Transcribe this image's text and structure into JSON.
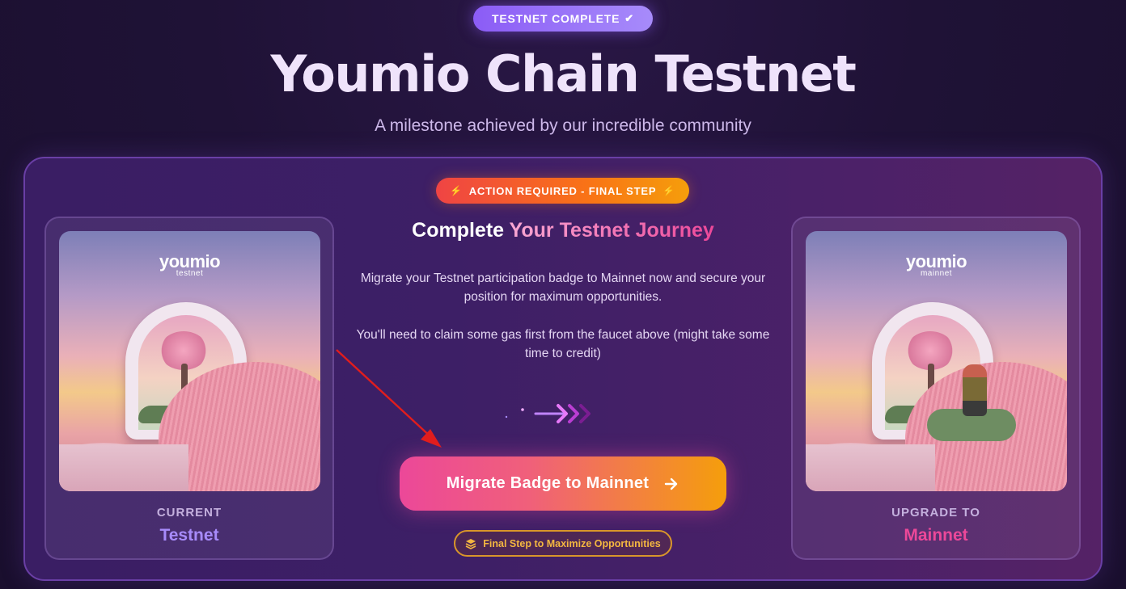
{
  "header": {
    "status_badge": "TESTNET COMPLETE",
    "title": "Youmio Chain Testnet",
    "subtitle": "A milestone achieved by our incredible community"
  },
  "panel": {
    "action_pill": "ACTION REQUIRED - FINAL STEP",
    "heading_prefix": "Complete ",
    "heading_highlight": "Your Testnet Journey",
    "description_1": "Migrate your Testnet participation badge to Mainnet now and secure your position for maximum opportunities.",
    "description_2": "You'll need to claim some gas first from the faucet above (might take some time to credit)",
    "migrate_button": "Migrate Badge to Mainnet",
    "final_step_pill": "Final Step to Maximize Opportunities"
  },
  "current_card": {
    "logo": "youmio",
    "logo_sub": "testnet",
    "label": "CURRENT",
    "value": "Testnet"
  },
  "upgrade_card": {
    "logo": "youmio",
    "logo_sub": "mainnet",
    "label": "UPGRADE TO",
    "value": "Mainnet"
  },
  "colors": {
    "accent_purple": "#8b5cf6",
    "accent_pink": "#ec4899",
    "accent_orange": "#f59e0b",
    "annotation_arrow": "#e11d1d"
  },
  "icons": [
    "check-icon",
    "bolt-icon",
    "arrow-right-icon",
    "layers-icon",
    "flow-arrows-icon"
  ]
}
